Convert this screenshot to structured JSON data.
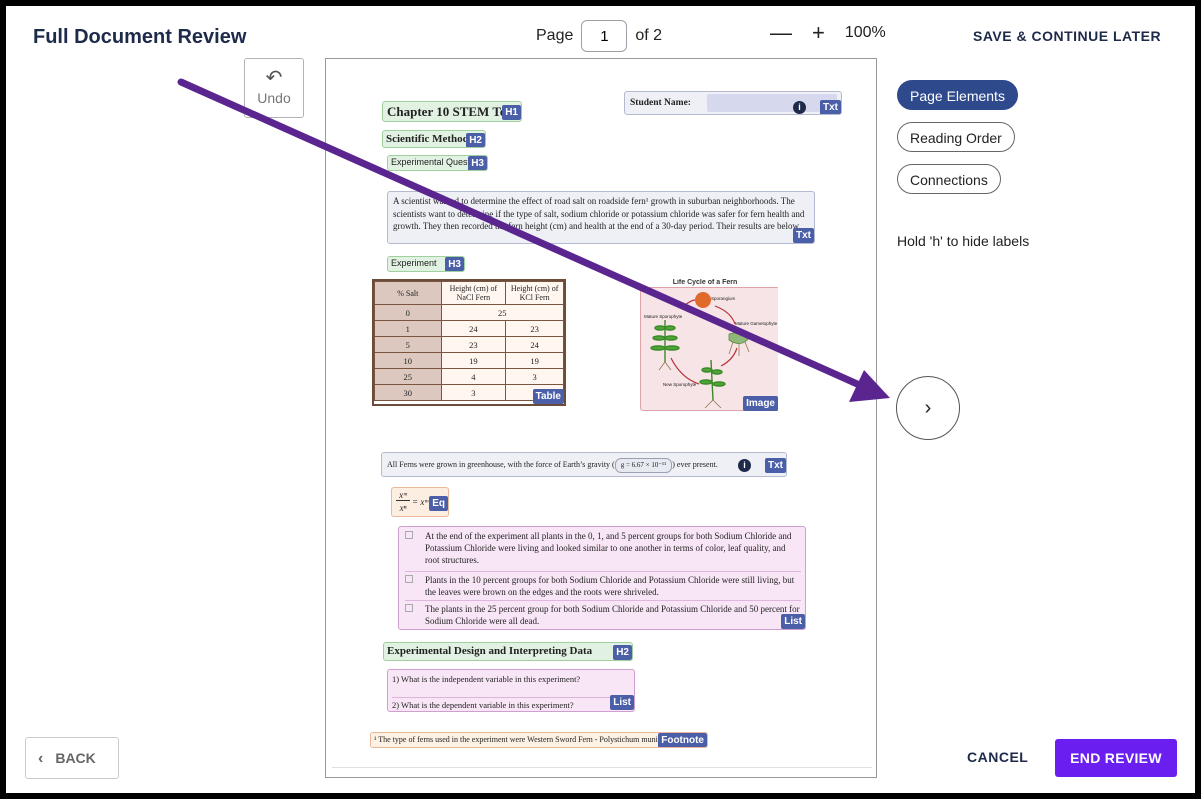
{
  "header": {
    "title": "Full Document Review",
    "page_label": "Page",
    "page_value": "1",
    "page_of": "of 2",
    "zoom_out": "—",
    "zoom_in": "+",
    "zoom_level": "100%",
    "save_later": "SAVE & CONTINUE LATER"
  },
  "undo": {
    "label": "Undo",
    "icon": "↶"
  },
  "sidebar": {
    "modes": [
      {
        "label": "Page Elements",
        "active": true
      },
      {
        "label": "Reading Order",
        "active": false
      },
      {
        "label": "Connections",
        "active": false
      }
    ],
    "hint": "Hold 'h' to hide labels",
    "next_icon": "›"
  },
  "footer": {
    "back_icon": "‹",
    "back": "BACK",
    "cancel": "CANCEL",
    "end_review": "END REVIEW"
  },
  "document": {
    "h1": {
      "text": "Chapter 10 STEM Test",
      "tag": "H1"
    },
    "student": {
      "label": "Student Name:",
      "tag": "Txt",
      "info": "i"
    },
    "h2_a": {
      "text": "Scientific Method",
      "tag": "H2"
    },
    "h3_a": {
      "text": "Experimental Question",
      "tag": "H3"
    },
    "paragraph": {
      "text": "A scientist wanted to determine the effect of road salt on roadside fern¹ growth in suburban neighborhoods. The scientists want to determine if the type of salt, sodium chloride or potassium chloride was safer for fern health and growth. They then recorded the fern height (cm) and health at the end of a 30-day period. Their results are below.",
      "tag": "Txt"
    },
    "h3_b": {
      "text": "Experiment",
      "tag": "H3"
    },
    "table": {
      "headers": [
        "% Salt",
        "Height (cm) of NaCl Fern",
        "Height (cm) of KCl Fern"
      ],
      "first_row": [
        "0",
        "25"
      ],
      "rows": [
        [
          "1",
          "24",
          "23"
        ],
        [
          "5",
          "23",
          "24"
        ],
        [
          "10",
          "19",
          "19"
        ],
        [
          "25",
          "4",
          "3"
        ],
        [
          "30",
          "3",
          ""
        ]
      ],
      "tag": "Table"
    },
    "figure": {
      "title": "Life Cycle of a Fern",
      "labels": [
        "Sporangium",
        "Mature Sporophyte",
        "Mature Gametophyte",
        "New Sporophyte"
      ],
      "tag": "Image"
    },
    "gravity": {
      "text": "All Ferns were grown in greenhouse, with the  force of Earth’s gravity (",
      "formula": "g = 6.67 × 10⁻¹¹",
      "after": ") ever present.",
      "tag": "Txt",
      "info": "i"
    },
    "equation": {
      "num": "xᵐ",
      "den": "xⁿ",
      "rhs": "= xᵐ⁻ⁿ",
      "tag": "Eq"
    },
    "list1": {
      "items": [
        "At the end of the experiment all plants in the 0, 1, and 5 percent groups for both Sodium Chloride and Potassium Chloride were living and looked similar to one another in terms of color,  leaf quality, and root structures.",
        "Plants in the 10 percent groups for both Sodium Chloride and Potassium Chloride were still living, but the leaves were brown on the edges and the roots were shriveled.",
        "The plants in the 25 percent group for both Sodium Chloride and Potassium Chloride and 50 percent for Sodium Chloride were all dead."
      ],
      "tag": "List"
    },
    "h2_b": {
      "text": "Experimental Design and Interpreting Data",
      "tag": "H2"
    },
    "list2": {
      "items": [
        "1)   What is the independent variable in this experiment?",
        "2)   What is the dependent variable in this experiment?"
      ],
      "tag": "List"
    },
    "footnote": {
      "text": "¹ The type of ferns used in the experiment were Western Sword Fern - Polystichum munitum",
      "tag": "Footnote"
    }
  },
  "colors": {
    "accent": "#6a1ff0",
    "active_pill": "#2e4a8c",
    "annotation_arrow": "#5b2590",
    "tag": "#4b5ea8"
  }
}
